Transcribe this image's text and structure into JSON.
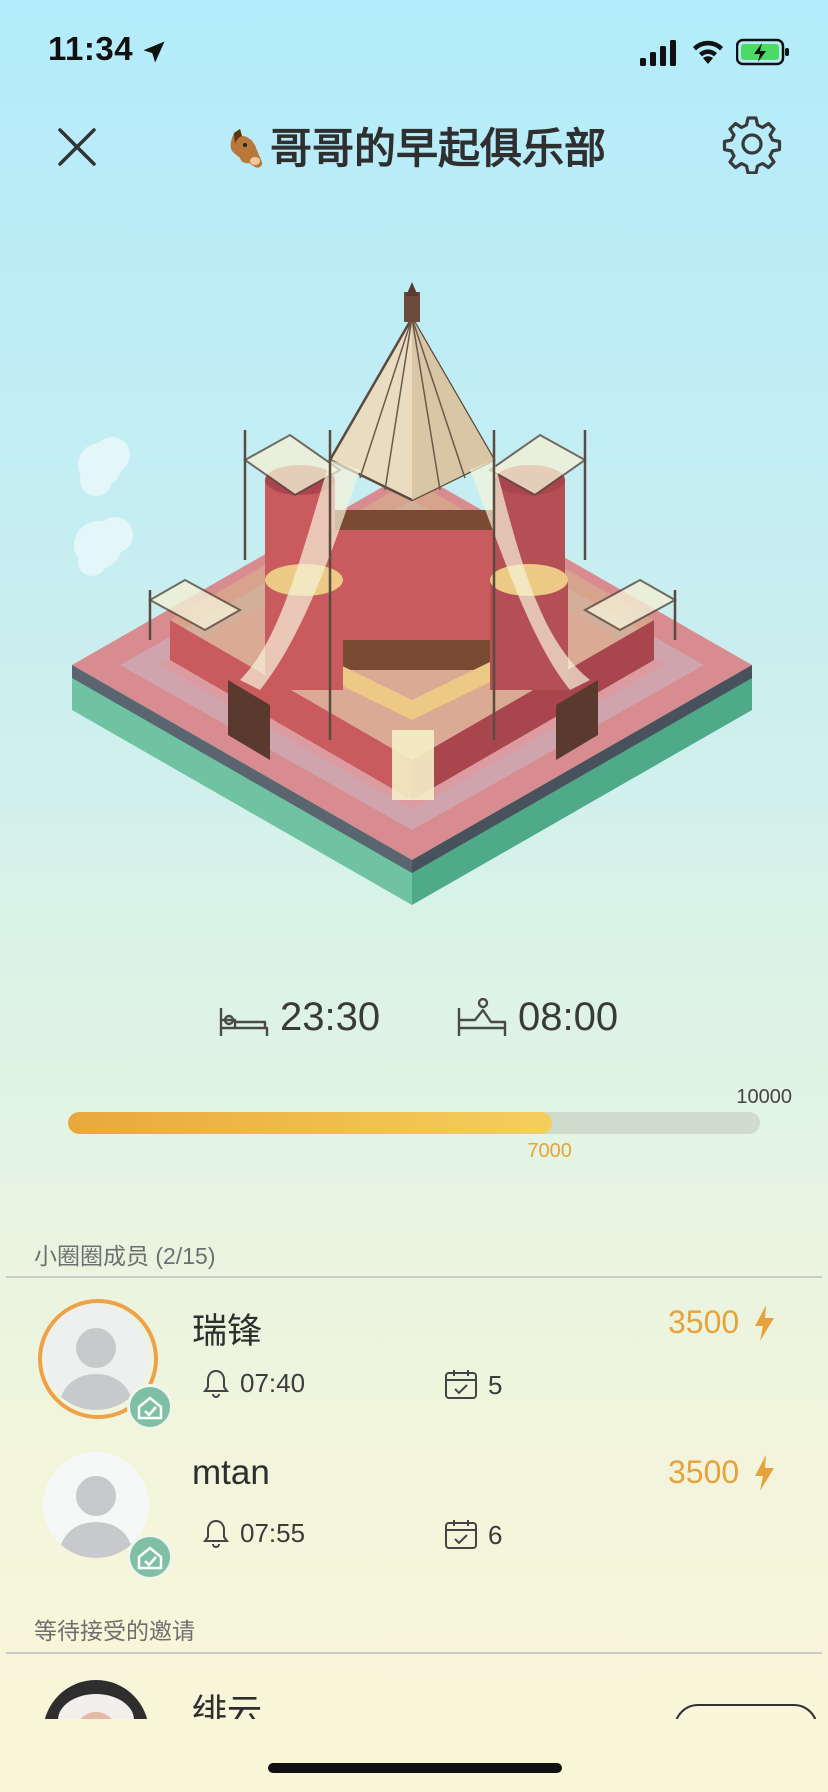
{
  "status_bar": {
    "time": "11:34"
  },
  "header": {
    "title": "哥哥的早起俱乐部",
    "title_emoji": "horse-face-icon"
  },
  "sleep": {
    "bedtime": "23:30",
    "wake_time": "08:00"
  },
  "progress": {
    "current": 7000,
    "max": 10000,
    "current_label": "7000",
    "max_label": "10000"
  },
  "members_section": {
    "label": "小圈圈成员 (2/15)"
  },
  "members": [
    {
      "name": "瑞锋",
      "score": "3500",
      "alarm": "07:40",
      "checkins": "5",
      "highlighted": true
    },
    {
      "name": "mtan",
      "score": "3500",
      "alarm": "07:55",
      "checkins": "6",
      "highlighted": false
    }
  ],
  "invites_section": {
    "label": "等待接受的邀请"
  },
  "invites": [
    {
      "name": "绯云"
    }
  ],
  "colors": {
    "accent": "#e8a23b",
    "badge": "#7fbfa6",
    "progress_track": "#cfdccc"
  }
}
